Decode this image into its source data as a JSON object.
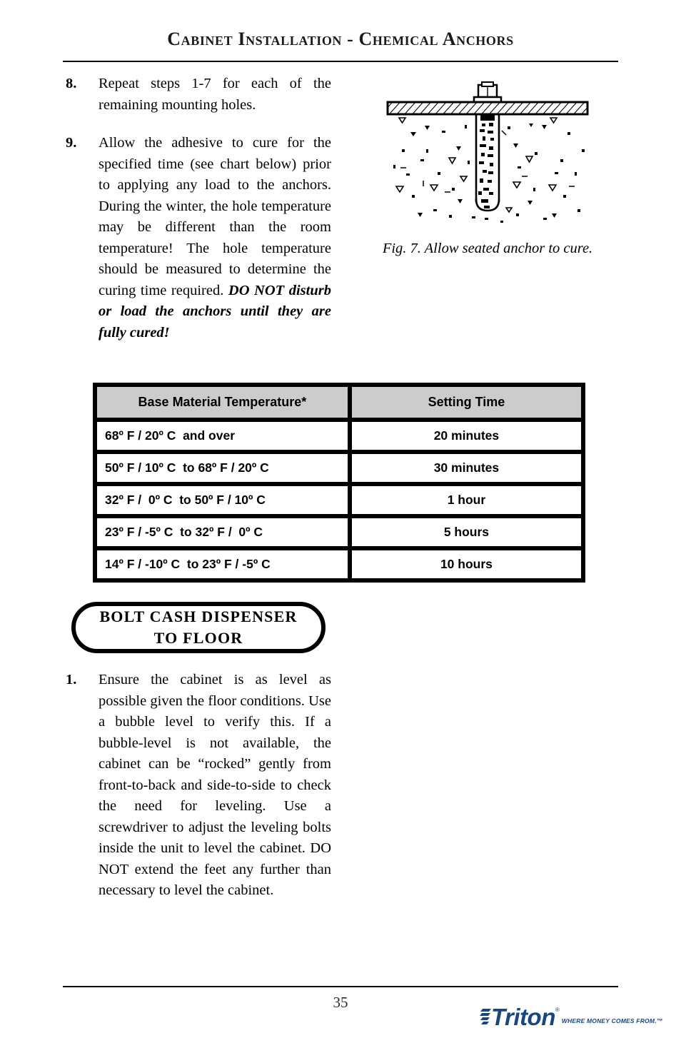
{
  "header": {
    "title": "Cabinet Installation - Chemical Anchors"
  },
  "steps_upper": [
    {
      "number": "8.",
      "text": "Repeat steps 1-7 for each of the remaining mounting holes."
    },
    {
      "number": "9.",
      "text_lead": "Allow the adhesive to cure for the specified time (see chart below) prior to applying any load to the anchors. During the winter, the hole temperature may be different than the room temperature! The hole temperature should be measured to determine the curing time required.  ",
      "text_emphasis": "DO NOT disturb or load the anchors until they are fully cured!"
    }
  ],
  "figure": {
    "name": "seated-anchor-diagram",
    "caption": "Fig. 7. Allow seated anchor to cure."
  },
  "table": {
    "columns": [
      "Base Material Temperature*",
      "Setting Time"
    ],
    "rows": [
      {
        "temperature": "68º F / 20º C  and over",
        "setting_time": "20 minutes"
      },
      {
        "temperature": "50º F / 10º C  to 68º F / 20º C",
        "setting_time": "30 minutes"
      },
      {
        "temperature": "32º F /  0º C  to 50º F / 10º C",
        "setting_time": "1 hour"
      },
      {
        "temperature": "23º F / -5º C  to 32º F /  0º C",
        "setting_time": "5 hours"
      },
      {
        "temperature": "14º F / -10º C  to 23º F / -5º C",
        "setting_time": "10 hours"
      }
    ],
    "header_background": "#cccccc"
  },
  "callout": {
    "text": "BOLT  CASH  DISPENSER\nTO  FLOOR"
  },
  "steps_lower": [
    {
      "number": "1.",
      "text": "Ensure the cabinet is as level as possible given the floor conditions. Use a bubble level to verify this. If a bubble-level is not available, the cabinet can be “rocked” gently from front-to-back and side-to-side to check the need for leveling. Use a screwdriver to adjust the leveling bolts inside the unit to level the cabinet. DO NOT extend the feet any further than necessary to level the cabinet."
    }
  ],
  "footer": {
    "page_number": "35",
    "logo_wordmark": "Triton",
    "logo_trademark": "®",
    "logo_tagline": "WHERE MONEY COMES FROM.™",
    "logo_color": "#17477f"
  }
}
